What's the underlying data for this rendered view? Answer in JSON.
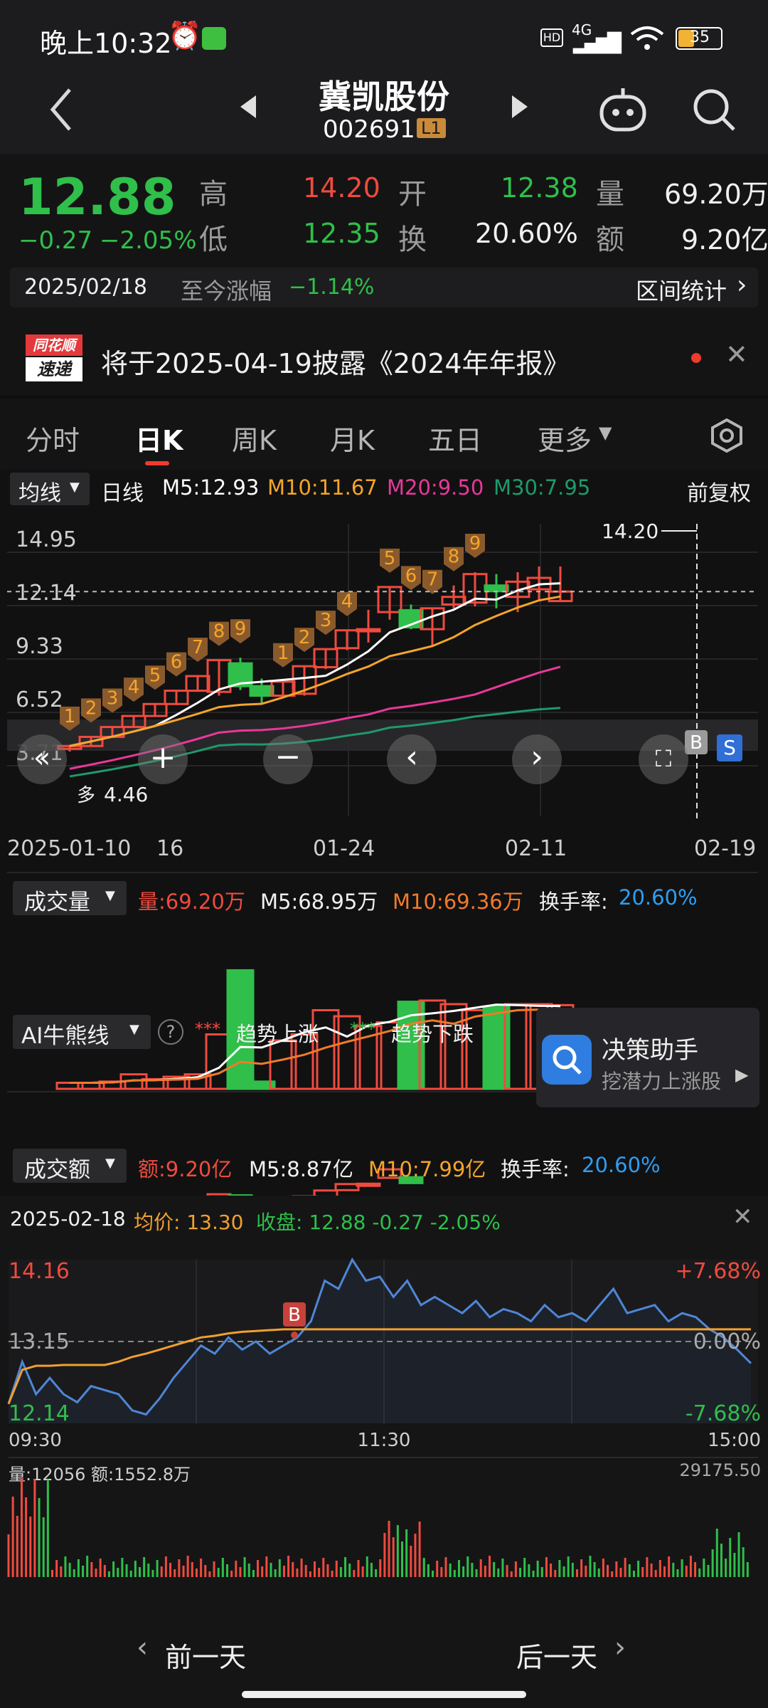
{
  "status_bar": {
    "time": "晚上10:32",
    "network": "4G",
    "battery": "35"
  },
  "header": {
    "stock_name": "冀凯股份",
    "stock_code": "002691",
    "level_badge": "L1"
  },
  "quote": {
    "price": "12.88",
    "change": "−0.27",
    "change_pct": "−2.05%",
    "high_label": "高",
    "high": "14.20",
    "open_label": "开",
    "open": "12.38",
    "vol_label": "量",
    "vol": "69.20万",
    "low_label": "低",
    "low": "12.35",
    "turnover_label": "换",
    "turnover": "20.60%",
    "amount_label": "额",
    "amount": "9.20亿",
    "date": "2025/02/18",
    "since_label": "至今涨幅",
    "since_value": "−1.14%",
    "range_stats": "区间统计"
  },
  "notice": {
    "badge_top": "同花顺",
    "badge_bottom": "速递",
    "text": "将于2025-04-19披露《2024年年报》"
  },
  "tabs": [
    "分时",
    "日K",
    "周K",
    "月K",
    "五日",
    "更多"
  ],
  "kline": {
    "ma_selector": "均线",
    "period": "日线",
    "ma5": "M5:12.93",
    "ma10": "M10:11.67",
    "ma20": "M20:9.50",
    "ma30": "M30:7.95",
    "adjust": "前复权",
    "y_ticks": [
      "14.95",
      "12.14",
      "9.33",
      "6.52",
      "3.71"
    ],
    "high_label": "14.20",
    "low_label": "4.46",
    "low_word": "多",
    "x_ticks": [
      "2025-01-10",
      "16",
      "01-24",
      "02-11",
      "02-19"
    ],
    "b_label": "B",
    "s_label": "S"
  },
  "volume": {
    "selector": "成交量",
    "vol": "量:69.20万",
    "m5": "M5:68.95万",
    "m10": "M10:69.36万",
    "turnover_label": "换手率:",
    "turnover": "20.60%"
  },
  "ai": {
    "selector": "AI牛熊线",
    "legend_up": "趋势上涨",
    "legend_down": "趋势下跌",
    "promo_title": "决策助手",
    "promo_sub": "挖潜力上涨股"
  },
  "amount": {
    "selector": "成交额",
    "amt": "额:9.20亿",
    "m5": "M5:8.87亿",
    "m10": "M10:7.99亿",
    "turnover_label": "换手率:",
    "turnover": "20.60%"
  },
  "intraday": {
    "date": "2025-02-18",
    "avg": "均价: 13.30",
    "close": "收盘: 12.88 -0.27 -2.05%",
    "y_high": "14.16",
    "y_mid": "13.15",
    "y_low": "12.14",
    "pct_high": "+7.68%",
    "pct_mid": "0.00%",
    "pct_low": "-7.68%",
    "t_start": "09:30",
    "t_mid": "11:30",
    "t_end": "15:00",
    "vol": "量:12056",
    "amt": "额:1552.8万",
    "vol_max": "29175.50",
    "b_label": "B"
  },
  "nav": {
    "prev": "前一天",
    "next": "后一天"
  },
  "colors": {
    "up": "#ef4b3e",
    "down": "#2fbf4a",
    "ma5": "#ffffff",
    "ma10": "#f4a52a",
    "ma20": "#e8389a",
    "ma30": "#1e9a6a",
    "price_line": "#4f86d6",
    "avg_line": "#f0a030",
    "accent_blue": "#2e9ef2"
  },
  "chart_data": [
    {
      "type": "candlestick",
      "title": "日K",
      "x_ticks": [
        "2025-01-10",
        "16",
        "01-24",
        "02-11",
        "02-19"
      ],
      "ylim": [
        3.71,
        14.95
      ],
      "y_ticks": [
        14.95,
        12.14,
        9.33,
        6.52,
        3.71
      ],
      "series": [
        {
          "ohlc": [
            [
              4.6,
              4.8,
              4.46,
              4.75
            ],
            [
              4.75,
              5.23,
              4.7,
              5.23
            ],
            [
              5.23,
              5.75,
              5.2,
              5.75
            ],
            [
              5.75,
              6.33,
              5.7,
              6.33
            ],
            [
              6.33,
              6.96,
              6.3,
              6.96
            ],
            [
              6.96,
              7.66,
              6.9,
              7.66
            ],
            [
              7.66,
              8.43,
              7.6,
              8.43
            ],
            [
              7.6,
              9.27,
              7.4,
              9.27
            ],
            [
              9.1,
              9.4,
              7.7,
              7.9
            ],
            [
              7.9,
              8.3,
              7.0,
              7.4
            ],
            [
              7.4,
              8.14,
              7.3,
              8.14
            ],
            [
              7.5,
              8.95,
              7.4,
              8.95
            ],
            [
              8.9,
              9.85,
              8.8,
              9.85
            ],
            [
              9.9,
              10.84,
              9.8,
              10.84
            ],
            [
              10.9,
              11.92,
              10.2,
              10.9
            ],
            [
              11.8,
              13.12,
              11.4,
              13.12
            ],
            [
              11.9,
              12.2,
              10.9,
              11.0
            ],
            [
              10.9,
              12.0,
              10.0,
              12.0
            ],
            [
              12.2,
              13.2,
              12.0,
              12.6
            ],
            [
              12.3,
              13.9,
              12.1,
              13.8
            ],
            [
              13.2,
              13.8,
              12.0,
              12.9
            ],
            [
              12.6,
              13.9,
              11.8,
              13.4
            ],
            [
              13.0,
              14.2,
              12.4,
              13.6
            ],
            [
              12.38,
              14.2,
              12.35,
              12.88
            ]
          ]
        }
      ],
      "ma": {
        "M5": 12.93,
        "M10": 11.67,
        "M20": 9.5,
        "M30": 7.95
      },
      "annotations": {
        "high": 14.2,
        "low": 4.46
      }
    },
    {
      "type": "bar",
      "title": "成交量",
      "values": [
        5,
        5,
        6,
        12,
        8,
        10,
        12,
        45,
        98,
        6,
        40,
        45,
        65,
        60,
        52,
        55,
        72,
        73,
        70,
        65,
        68,
        70,
        70,
        69.2
      ],
      "ma": {
        "M5": 68.95,
        "M10": 69.36
      },
      "unit": "万"
    },
    {
      "type": "line",
      "title": "分时",
      "ylim": [
        12.14,
        14.16
      ],
      "x_ticks": [
        "09:30",
        "11:30",
        "15:00"
      ],
      "series": [
        {
          "name": "收盘",
          "values": [
            12.38,
            12.9,
            12.5,
            12.7,
            12.5,
            12.4,
            12.6,
            12.55,
            12.5,
            12.3,
            12.25,
            12.45,
            12.7,
            12.9,
            13.1,
            13.0,
            13.2,
            13.05,
            13.15,
            13.0,
            13.1,
            13.2,
            13.4,
            13.9,
            13.8,
            14.16,
            13.9,
            13.95,
            13.7,
            13.9,
            13.6,
            13.7,
            13.6,
            13.5,
            13.65,
            13.45,
            13.55,
            13.5,
            13.4,
            13.6,
            13.45,
            13.5,
            13.4,
            13.6,
            13.8,
            13.5,
            13.55,
            13.6,
            13.4,
            13.5,
            13.45,
            13.3,
            13.2,
            13.05,
            12.88
          ]
        },
        {
          "name": "均价",
          "values": [
            12.38,
            12.8,
            12.85,
            12.85,
            12.86,
            12.86,
            12.86,
            12.86,
            12.9,
            12.96,
            13.0,
            13.05,
            13.1,
            13.15,
            13.2,
            13.22,
            13.25,
            13.27,
            13.28,
            13.29,
            13.3,
            13.3,
            13.3,
            13.3,
            13.3,
            13.3,
            13.3,
            13.3,
            13.3,
            13.3,
            13.3,
            13.3,
            13.3,
            13.3,
            13.3,
            13.3,
            13.3,
            13.3,
            13.3,
            13.3,
            13.3,
            13.3,
            13.3,
            13.3,
            13.3,
            13.3,
            13.3,
            13.3,
            13.3,
            13.3,
            13.3,
            13.3,
            13.3,
            13.3,
            13.3
          ]
        }
      ]
    }
  ]
}
